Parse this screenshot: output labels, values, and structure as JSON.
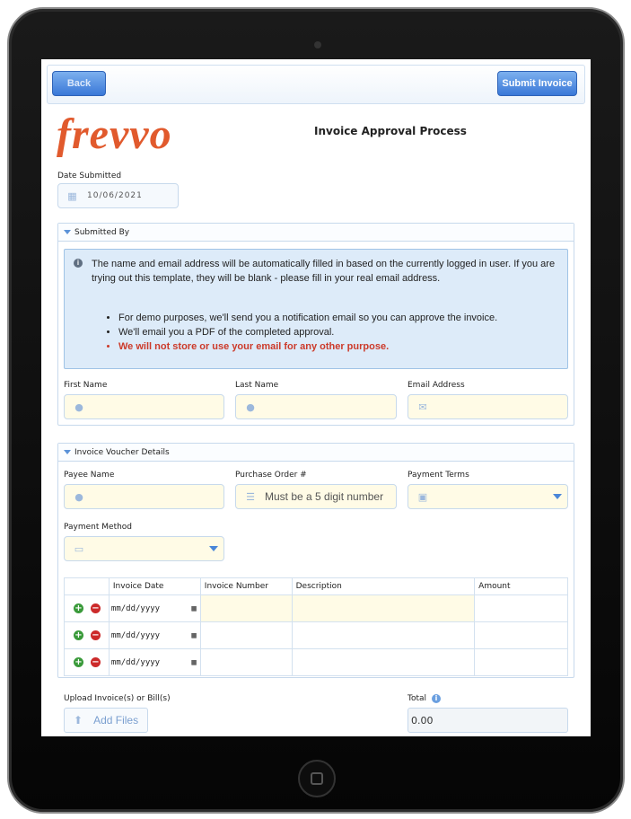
{
  "toolbar": {
    "back_label": "Back",
    "submit_label": "Submit Invoice"
  },
  "logo_text": "frevvo",
  "page_title": "Invoice Approval Process",
  "date_submitted": {
    "label": "Date Submitted",
    "value": "10/06/2021"
  },
  "submitted_by": {
    "header": "Submitted By",
    "info_paragraph": "The name and email address will be automatically filled in based on the currently logged in user. If you are trying out this template, they will be blank - please fill in your real email address.",
    "bullets": [
      "For demo purposes, we'll send you a notification email so you can approve the invoice.",
      "We'll email you a PDF of the completed approval.",
      "We will not store or use your email for any other purpose."
    ],
    "first_name_label": "First Name",
    "last_name_label": "Last Name",
    "email_label": "Email Address"
  },
  "voucher": {
    "header": "Invoice Voucher Details",
    "payee_label": "Payee Name",
    "po_label": "Purchase Order #",
    "po_placeholder": "Must be a 5 digit number",
    "terms_label": "Payment Terms",
    "method_label": "Payment Method"
  },
  "table": {
    "headers": [
      "Invoice Date",
      "Invoice Number",
      "Description",
      "Amount"
    ],
    "date_placeholder": "mm/dd/yyyy"
  },
  "upload": {
    "label": "Upload Invoice(s) or Bill(s)",
    "button_label": "Add Files"
  },
  "total": {
    "label": "Total",
    "value": "0.00"
  },
  "colors": {
    "accent": "#3a78d8",
    "logo": "#e15a2d",
    "warning": "#cc3a2a",
    "field_bg": "#fffbe6"
  }
}
